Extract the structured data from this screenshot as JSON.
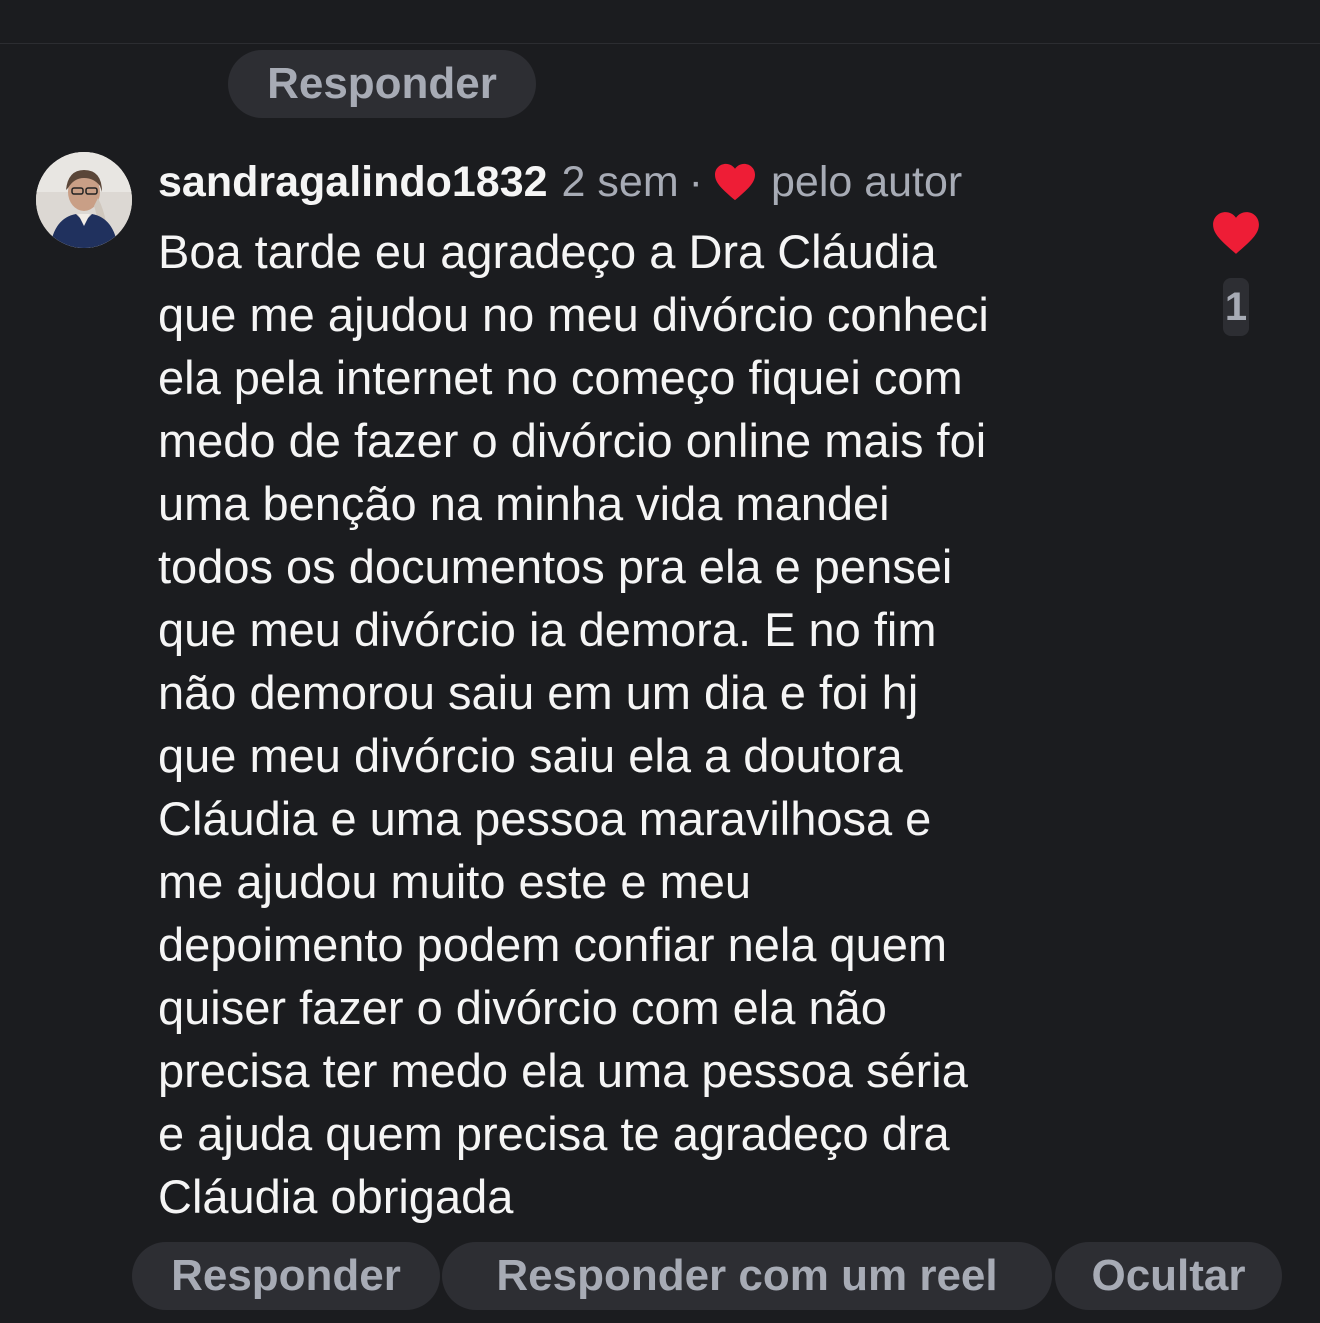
{
  "top_reply_button": "Responder",
  "comment": {
    "username": "sandragalindo1832",
    "time": "2 sem",
    "separator": "·",
    "liked_by_author": "pelo autor",
    "text_lines": [
      "Boa tarde eu agradeço a Dra Cláudia",
      "que me ajudou no meu divórcio conheci",
      "ela pela internet no começo fiquei com",
      "medo de fazer o divórcio online mais foi",
      "uma benção na minha vida mandei",
      "todos os documentos pra ela e pensei",
      "que meu divórcio ia demora. E no fim",
      "não demorou saiu em um dia e foi hj",
      "que meu divórcio saiu ela a doutora",
      "Cláudia e uma pessoa maravilhosa e",
      "me ajudou muito este e meu",
      "depoimento podem confiar nela quem",
      "quiser fazer o divórcio com ela não",
      "precisa ter medo ela uma pessoa séria",
      "e ajuda quem precisa te agradeço dra",
      "Cláudia obrigada"
    ],
    "like_count": "1",
    "liked": true
  },
  "actions": {
    "reply": "Responder",
    "reply_reel": "Responder com um reel",
    "hide": "Ocultar"
  },
  "icons": {
    "author_heart": "heart-icon",
    "like_heart": "heart-icon"
  },
  "colors": {
    "background": "#1b1c1f",
    "pill": "#2d2e33",
    "muted_text": "#a7abb5",
    "heart": "#ee1d36"
  }
}
